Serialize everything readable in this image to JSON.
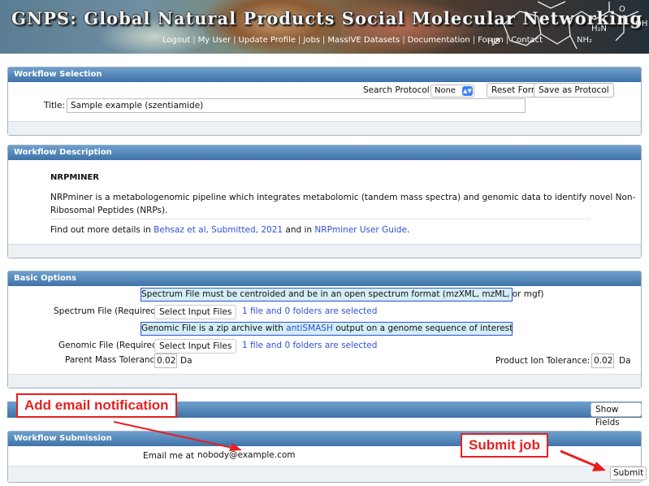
{
  "header": {
    "title": "GNPS: Global Natural Products Social Molecular Networking",
    "nav": [
      "Logout",
      "My User",
      "Update Profile",
      "Jobs",
      "MassIVE Datasets",
      "Documentation",
      "Forum",
      "Contact"
    ],
    "molecule_labels": {
      "ho": "HO",
      "nh2": "NH₂",
      "h2n": "H₂N",
      "o": "O",
      "oh": "OH"
    }
  },
  "workflow_selection": {
    "header": "Workflow Selection",
    "search_protocol_label": "Search Protocol:",
    "search_protocol_value": "None",
    "reset_form": "Reset Form",
    "save_as_protocol": "Save as Protocol",
    "title_label": "Title:",
    "title_value": "Sample example (szentiamide)"
  },
  "workflow_description": {
    "header": "Workflow Description",
    "name": "NRPMINER",
    "description_line1": "NRPminer is a metabologenomic pipeline which integrates metabolomic (tandem mass spectra) and genomic data to identify novel Non-",
    "description_line2": "Ribosomal Peptides (NRPs).",
    "details_prefix": "Find out more details in",
    "details_link1": "Behsaz et al, Submitted, 2021",
    "details_mid": "and in",
    "details_link2": "NRPminer User Guide",
    "details_suffix": "."
  },
  "basic_options": {
    "header": "Basic Options",
    "spectrum_notice": "Spectrum File must be centroided and be in an open spectrum format (mzXML, mzML, or mgf)",
    "spectrum_label": "Spectrum File (Required):",
    "spectrum_button": "Select Input Files",
    "spectrum_status": "1 file and 0 folders are selected",
    "genomic_notice_prefix": "Genomic File is a zip archive with",
    "genomic_notice_link": "antiSMASH",
    "genomic_notice_suffix": "output on a genome sequence of interest",
    "genomic_label": "Genomic File (Required):",
    "genomic_button": "Select Input Files",
    "genomic_status": "1 file and 0 folders are selected",
    "parent_tol_label": "Parent Mass Tolerance:",
    "parent_tol_value": "0.02",
    "parent_tol_unit": "Da",
    "product_tol_label": "Product Ion Tolerance:",
    "product_tol_value": "0.02",
    "product_tol_unit": "Da"
  },
  "email_notification": {
    "show_fields": "Show Fields"
  },
  "workflow_submission": {
    "header": "Workflow Submission",
    "email_label": "Email me at",
    "email_value": "nobody@example.com",
    "submit": "Submit"
  },
  "annotations": {
    "add_email": "Add email notification",
    "submit_job": "Submit job",
    "color": "#e62020"
  }
}
